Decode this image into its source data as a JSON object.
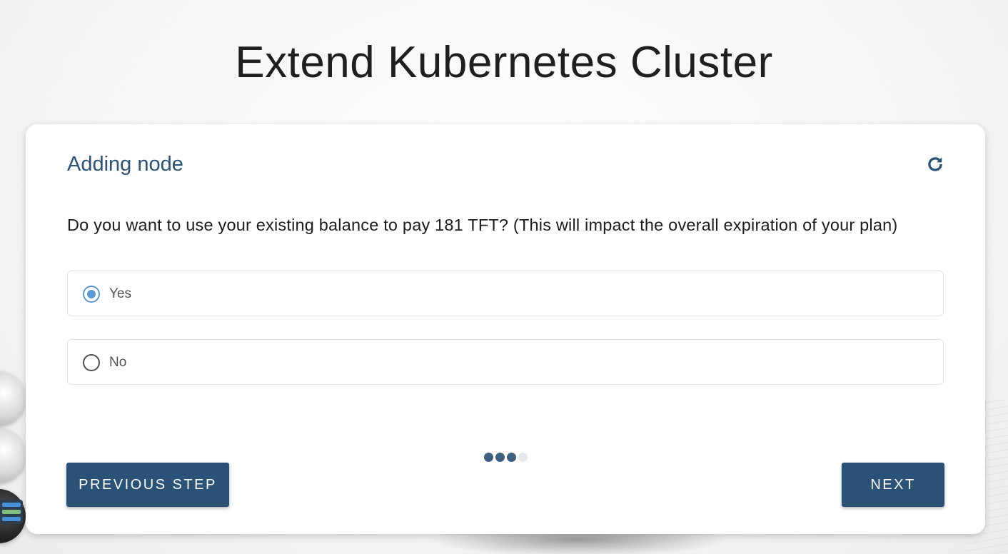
{
  "page": {
    "title": "Extend Kubernetes Cluster"
  },
  "card": {
    "header": "Adding node",
    "refresh_icon": "refresh-icon",
    "question": "Do you want to use your existing balance to pay 181 TFT? (This will impact the overall expiration of your plan)",
    "options": [
      {
        "label": "Yes",
        "selected": true
      },
      {
        "label": "No",
        "selected": false
      }
    ],
    "steps": {
      "total": 4,
      "completed": 3
    },
    "buttons": {
      "previous_label": "PREVIOUS STEP",
      "next_label": "NEXT"
    }
  },
  "colors": {
    "primary": "#2a5276",
    "radio_accent": "#5b9bd5",
    "step_active": "#3f5f7e",
    "step_inactive": "#e6e9ec"
  }
}
